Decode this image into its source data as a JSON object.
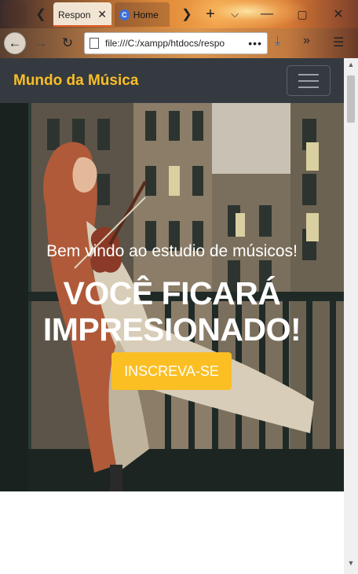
{
  "browser": {
    "tabs": [
      {
        "label": "Respon",
        "active": true
      },
      {
        "label": "Home",
        "active": false,
        "favicon": "C"
      }
    ],
    "url": "file:///C:/xampp/htdocs/respo",
    "url_dots": "•••"
  },
  "site": {
    "brand": "Mundo da Música",
    "brand_color": "#fbbf24",
    "nav_bg": "#343a40"
  },
  "hero": {
    "welcome": "Bem vindo ao estudio de músicos!",
    "headline_line1": "VOCÊ FICARÁ",
    "headline_line2": "IMPRESIONADO!",
    "cta_label": "INSCREVA-SE",
    "cta_color": "#fbbf24",
    "illustration": "woman-playing-violin-on-balcony-illustration"
  }
}
